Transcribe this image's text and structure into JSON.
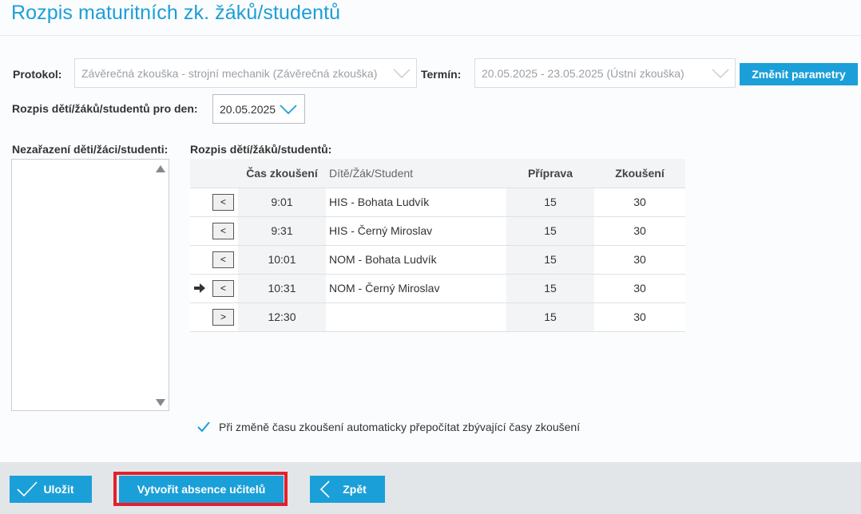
{
  "page_title": "Rozpis maturitních zk. žáků/studentů",
  "filters": {
    "protokol_label": "Protokol:",
    "protokol_value": "Závěrečná zkouška - strojní mechanik (Závěrečná zkouška)",
    "termin_label": "Termín:",
    "termin_value": "20.05.2025 - 23.05.2025 (Ústní zkouška)",
    "change_button": "Změnit parametry",
    "day_label": "Rozpis dětí/žáků/studentů pro den:",
    "day_value": "20.05.2025"
  },
  "unassigned": {
    "label": "Nezařazení děti/žáci/studenti:"
  },
  "schedule": {
    "label": "Rozpis dětí/žáků/studentů:",
    "columns": {
      "time": "Čas zkoušení",
      "student": "Dítě/Žák/Student",
      "prep": "Příprava",
      "exam": "Zkoušení"
    },
    "rows": [
      {
        "button": "<",
        "time": "9:01",
        "student": "HIS - Bohata Ludvík",
        "prep": "15",
        "exam": "30",
        "pointer": false
      },
      {
        "button": "<",
        "time": "9:31",
        "student": "HIS - Černý Miroslav",
        "prep": "15",
        "exam": "30",
        "pointer": false
      },
      {
        "button": "<",
        "time": "10:01",
        "student": "NOM - Bohata Ludvík",
        "prep": "15",
        "exam": "30",
        "pointer": false
      },
      {
        "button": "<",
        "time": "10:31",
        "student": "NOM - Černý Miroslav",
        "prep": "15",
        "exam": "30",
        "pointer": true
      },
      {
        "button": ">",
        "time": "12:30",
        "student": "",
        "prep": "15",
        "exam": "30",
        "pointer": false
      }
    ]
  },
  "recalc_option": {
    "label": "Při změně času zkoušení automaticky přepočítat zbývající časy zkoušení",
    "checked": true
  },
  "footer": {
    "save": "Uložit",
    "create_absence": "Vytvořit absence učitelů",
    "back": "Zpět"
  },
  "colors": {
    "accent": "#1b9fd8",
    "highlight": "#e4202a"
  }
}
